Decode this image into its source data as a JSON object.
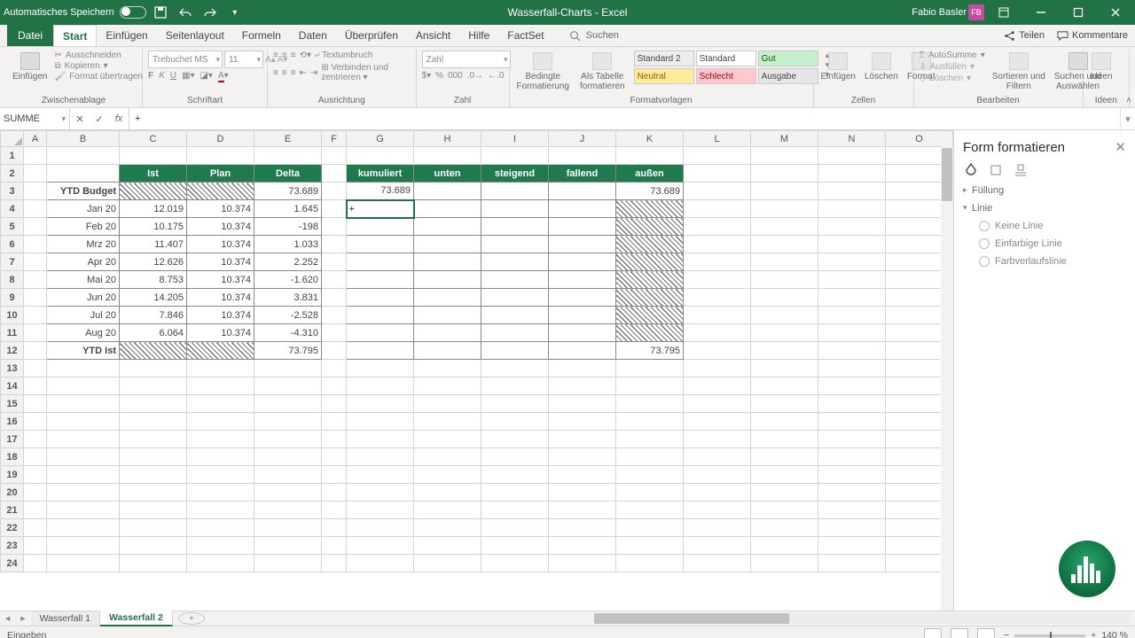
{
  "titlebar": {
    "autosave": "Automatisches Speichern",
    "doc": "Wasserfall-Charts  -  Excel",
    "user": "Fabio Basler",
    "initials": "FB"
  },
  "menutabs": {
    "file": "Datei",
    "items": [
      "Start",
      "Einfügen",
      "Seitenlayout",
      "Formeln",
      "Daten",
      "Überprüfen",
      "Ansicht",
      "Hilfe",
      "FactSet"
    ],
    "active": 0,
    "search": "Suchen",
    "share": "Teilen",
    "comments": "Kommentare"
  },
  "ribbon": {
    "clipboard": {
      "paste": "Einfügen",
      "cut": "Ausschneiden",
      "copy": "Kopieren",
      "format": "Format übertragen",
      "label": "Zwischenablage"
    },
    "font": {
      "family": "Trebuchet MS",
      "size": "11",
      "label": "Schriftart"
    },
    "align": {
      "wrap": "Textumbruch",
      "merge": "Verbinden und zentrieren",
      "label": "Ausrichtung"
    },
    "number": {
      "format": "Zahl",
      "label": "Zahl"
    },
    "cond": {
      "conditional": "Bedingte\nFormatierung",
      "astable": "Als Tabelle\nformatieren"
    },
    "styles": {
      "cells": [
        "Standard 2",
        "Standard",
        "Gut",
        "Neutral",
        "Schlecht",
        "Ausgabe"
      ],
      "label": "Formatvorlagen"
    },
    "cells": {
      "insert": "Einfügen",
      "delete": "Löschen",
      "format": "Format",
      "label": "Zellen"
    },
    "editing": {
      "sum": "AutoSumme",
      "fill": "Ausfüllen",
      "clear": "Löschen",
      "sort": "Sortieren und\nFiltern",
      "find": "Suchen und\nAuswählen",
      "label": "Bearbeiten"
    },
    "ideas": {
      "btn": "Ideen",
      "label": "Ideen"
    }
  },
  "fx": {
    "name": "SUMME",
    "formula": "+"
  },
  "columns": [
    "A",
    "B",
    "C",
    "D",
    "E",
    "F",
    "G",
    "H",
    "I",
    "J",
    "K",
    "L",
    "M",
    "N",
    "O"
  ],
  "sheet": {
    "headers1": {
      "C": "Ist",
      "D": "Plan",
      "E": "Delta"
    },
    "headers2": {
      "G": "kumuliert",
      "H": "unten",
      "I": "steigend",
      "J": "fallend",
      "K": "außen"
    },
    "rows": [
      {
        "r": 3,
        "B": "YTD Budget",
        "E": "73.689",
        "G": "73.689",
        "K": "73.689"
      },
      {
        "r": 4,
        "B": "Jan 20",
        "C": "12.019",
        "D": "10.374",
        "E": "1.645",
        "G": "+"
      },
      {
        "r": 5,
        "B": "Feb 20",
        "C": "10.175",
        "D": "10.374",
        "E": "-198"
      },
      {
        "r": 6,
        "B": "Mrz 20",
        "C": "11.407",
        "D": "10.374",
        "E": "1.033"
      },
      {
        "r": 7,
        "B": "Apr 20",
        "C": "12.626",
        "D": "10.374",
        "E": "2.252"
      },
      {
        "r": 8,
        "B": "Mai 20",
        "C": "8.753",
        "D": "10.374",
        "E": "-1.620"
      },
      {
        "r": 9,
        "B": "Jun 20",
        "C": "14.205",
        "D": "10.374",
        "E": "3.831"
      },
      {
        "r": 10,
        "B": "Jul 20",
        "C": "7.846",
        "D": "10.374",
        "E": "-2.528"
      },
      {
        "r": 11,
        "B": "Aug 20",
        "C": "6.064",
        "D": "10.374",
        "E": "-4.310"
      },
      {
        "r": 12,
        "B": "YTD Ist",
        "E": "73.795",
        "K": "73.795"
      }
    ]
  },
  "sidepane": {
    "title": "Form formatieren",
    "fill": "Füllung",
    "line": "Linie",
    "opts": [
      "Keine Linie",
      "Einfarbige Linie",
      "Farbverlaufslinie"
    ]
  },
  "sheettabs": {
    "tabs": [
      "Wasserfall 1",
      "Wasserfall 2"
    ],
    "active": 1
  },
  "status": {
    "left": "Eingeben",
    "zoom": "140 %"
  }
}
